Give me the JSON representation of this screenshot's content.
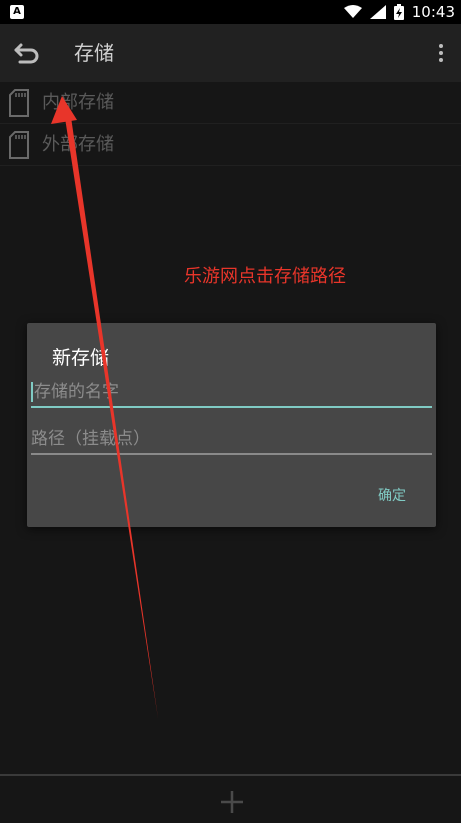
{
  "status_bar": {
    "app_badge": "A",
    "time": "10:43"
  },
  "app_bar": {
    "title": "存储",
    "back_icon": "back-arrow-icon",
    "menu_icon": "overflow-menu-icon"
  },
  "storage_list": {
    "items": [
      {
        "label": "内部存储",
        "icon": "sd-card-icon"
      },
      {
        "label": "外部存储",
        "icon": "sd-card-icon"
      }
    ]
  },
  "annotation": {
    "text": "乐游网点击存储路径",
    "color": "#e8352a"
  },
  "dialog": {
    "title": "新存储",
    "name_field": {
      "placeholder": "存储的名字",
      "value": ""
    },
    "path_field": {
      "placeholder": "路径（挂载点）",
      "value": ""
    },
    "confirm_label": "确定",
    "accent_color": "#80cbc4"
  },
  "bottom_bar": {
    "add_icon": "plus-icon"
  }
}
